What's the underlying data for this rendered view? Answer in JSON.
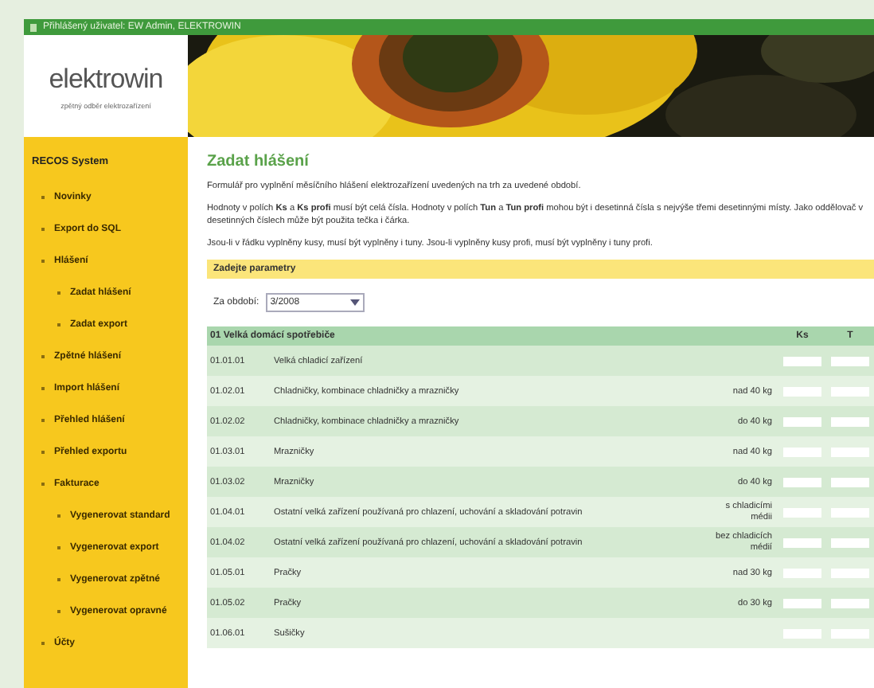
{
  "top_bar": {
    "user": "Přihlášený uživatel: EW Admin, ELEKTROWIN"
  },
  "logo": {
    "name": "elektrowin",
    "tagline": "zpětný odběr elektrozařízení"
  },
  "sidebar": {
    "title": "RECOS System",
    "items": [
      {
        "label": "Novinky"
      },
      {
        "label": "Export do SQL"
      },
      {
        "label": "Hlášení",
        "children": [
          {
            "label": "Zadat hlášení"
          },
          {
            "label": "Zadat export"
          }
        ]
      },
      {
        "label": "Zpětné hlášení"
      },
      {
        "label": "Import hlášení"
      },
      {
        "label": "Přehled hlášení"
      },
      {
        "label": "Přehled exportu"
      },
      {
        "label": "Fakturace",
        "children": [
          {
            "label": "Vygenerovat standard"
          },
          {
            "label": "Vygenerovat export"
          },
          {
            "label": "Vygenerovat zpětné"
          },
          {
            "label": "Vygenerovat opravné"
          }
        ]
      },
      {
        "label": "Účty"
      }
    ]
  },
  "content": {
    "title": "Zadat hlášení",
    "paragraphs": [
      "Formulář pro vyplnění měsíčního hlášení elektrozařízení uvedených na trh za uvedené období.",
      "Hodnoty v polích **Ks** a **Ks profi** musí být celá čísla. Hodnoty v polích **Tun** a **Tun profi** mohou být i desetinná čísla s nejvýše třemi desetinnými místy. Jako oddělovač v desetinných číslech může být použita tečka i čárka.",
      "Jsou-li v řádku vyplněny kusy, musí být vyplněny i tuny. Jsou-li vyplněny kusy profi, musí být vyplněny i tuny profi."
    ],
    "params_title": "Zadejte parametry",
    "period": {
      "label": "Za období:",
      "value": "3/2008"
    },
    "table": {
      "group": "01 Velká domácí spotřebiče",
      "columns": [
        "Ks",
        "T"
      ],
      "rows": [
        {
          "code": "01.01.01",
          "name": "Velká chladicí zařízení",
          "qualifier": ""
        },
        {
          "code": "01.02.01",
          "name": "Chladničky, kombinace chladničky a mrazničky",
          "qualifier": "nad 40 kg"
        },
        {
          "code": "01.02.02",
          "name": "Chladničky, kombinace chladničky a mrazničky",
          "qualifier": "do 40 kg"
        },
        {
          "code": "01.03.01",
          "name": "Mrazničky",
          "qualifier": "nad 40 kg"
        },
        {
          "code": "01.03.02",
          "name": "Mrazničky",
          "qualifier": "do 40 kg"
        },
        {
          "code": "01.04.01",
          "name": "Ostatní velká zařízení používaná pro chlazení, uchování a skladování potravin",
          "qualifier": "s chladicími médii"
        },
        {
          "code": "01.04.02",
          "name": "Ostatní velká zařízení používaná pro chlazení, uchování a skladování potravin",
          "qualifier": "bez chladicích médií"
        },
        {
          "code": "01.05.01",
          "name": "Pračky",
          "qualifier": "nad 30 kg"
        },
        {
          "code": "01.05.02",
          "name": "Pračky",
          "qualifier": "do 30 kg"
        },
        {
          "code": "01.06.01",
          "name": "Sušičky",
          "qualifier": ""
        }
      ]
    }
  }
}
